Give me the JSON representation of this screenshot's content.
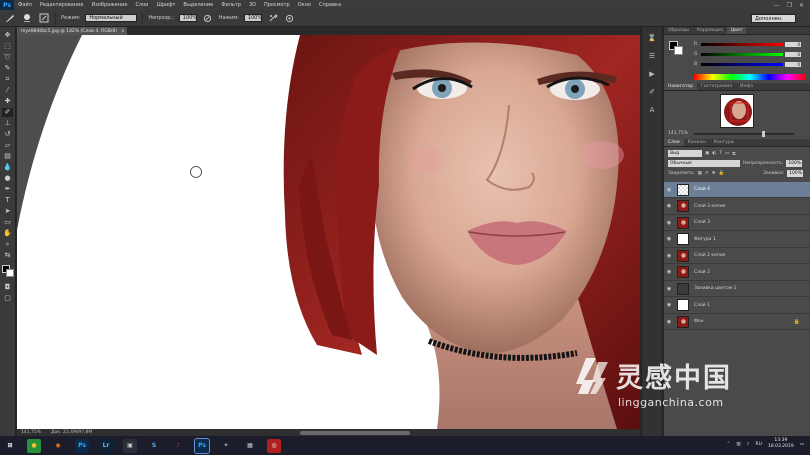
{
  "menubar": {
    "logo": "Ps",
    "items": [
      "Файл",
      "Редактирование",
      "Изображение",
      "Слои",
      "Шрифт",
      "Выделение",
      "Фильтр",
      "3D",
      "Просмотр",
      "Окно",
      "Справка"
    ],
    "window_controls": [
      "—",
      "❐",
      "✕"
    ]
  },
  "options": {
    "mode_label": "Режим:",
    "mode_value": "Нормальный",
    "opacity_label": "Непрозр.:",
    "opacity_value": "100%",
    "flow_label": "Нажим:",
    "flow_value": "100%",
    "workspace": "Дополнен."
  },
  "document": {
    "tab_title": "mya9840bc5.jpg @ 142% (Слой 4, RGB/8)",
    "tab_close": "×",
    "zoom": "141,75%",
    "doc_info": "Док: 22,4M/97,8M"
  },
  "color_panel": {
    "tabs": [
      "Образцы",
      "Коррекция",
      "Цвет"
    ],
    "active_tab": 2,
    "sliders": [
      {
        "label": "R",
        "value": "0",
        "gradient": "linear-gradient(90deg,#000,#f00)"
      },
      {
        "label": "G",
        "value": "0",
        "gradient": "linear-gradient(90deg,#000,#0f0)"
      },
      {
        "label": "B",
        "value": "0",
        "gradient": "linear-gradient(90deg,#000,#00f)"
      }
    ]
  },
  "navigator_panel": {
    "tabs": [
      "Навигатор",
      "Гистограмма",
      "Инфо"
    ],
    "active_tab": 0,
    "zoom": "141,75%"
  },
  "layers_panel": {
    "tabs": [
      "Слои",
      "Каналы",
      "Контуры"
    ],
    "active_tab": 0,
    "kind_filter": "Вид",
    "blend_mode": "Обычные",
    "opacity_label": "Непрозрачность:",
    "opacity_value": "100%",
    "lock_label": "Закрепить:",
    "fill_label": "Заливка:",
    "fill_value": "100%",
    "layers": [
      {
        "name": "Слой 4",
        "thumb": "transparent",
        "selected": true,
        "lock": ""
      },
      {
        "name": "Слой 3 копия",
        "thumb": "photo",
        "selected": false,
        "lock": ""
      },
      {
        "name": "Слой 3",
        "thumb": "photo",
        "selected": false,
        "lock": ""
      },
      {
        "name": "Фигура 1",
        "thumb": "white",
        "selected": false,
        "lock": ""
      },
      {
        "name": "Слой 2 копия",
        "thumb": "photo",
        "selected": false,
        "lock": ""
      },
      {
        "name": "Слой 2",
        "thumb": "photo",
        "selected": false,
        "lock": ""
      },
      {
        "name": "Заливка цветом 1",
        "thumb": "fill",
        "selected": false,
        "lock": ""
      },
      {
        "name": "Слой 1",
        "thumb": "white",
        "selected": false,
        "lock": ""
      },
      {
        "name": "Фон",
        "thumb": "photo",
        "selected": false,
        "lock": "🔒"
      }
    ]
  },
  "taskbar": {
    "apps": [
      {
        "label": "⊞",
        "color": "#1b1e2a",
        "fg": "#ffffff"
      },
      {
        "label": "●",
        "color": "#2a8f3a",
        "fg": "#f2c12e"
      },
      {
        "label": "◉",
        "color": "#1b1e2a",
        "fg": "#f07b1b"
      },
      {
        "label": "Ps",
        "color": "#0c2a4a",
        "fg": "#31a8ff"
      },
      {
        "label": "Lr",
        "color": "#0e2235",
        "fg": "#64b8f0"
      },
      {
        "label": "▣",
        "color": "#2b2f3a",
        "fg": "#d0d0d0"
      },
      {
        "label": "S",
        "color": "#1b1e2a",
        "fg": "#5aaeea"
      },
      {
        "label": "♪",
        "color": "#1b1e2a",
        "fg": "#d23"
      },
      {
        "label": "Ps",
        "color": "#0c2a4a",
        "fg": "#31a8ff"
      },
      {
        "label": "✦",
        "color": "#1b1e2a",
        "fg": "#9ad"
      },
      {
        "label": "▦",
        "color": "#1b1e2a",
        "fg": "#ccc"
      },
      {
        "label": "◎",
        "color": "#b02020",
        "fg": "#fff"
      }
    ],
    "active_index": 8,
    "lang": "RU",
    "time": "13:39",
    "date": "18.03.2019"
  },
  "watermark": {
    "cn": "灵感中国",
    "en": "lingganchina.com"
  }
}
